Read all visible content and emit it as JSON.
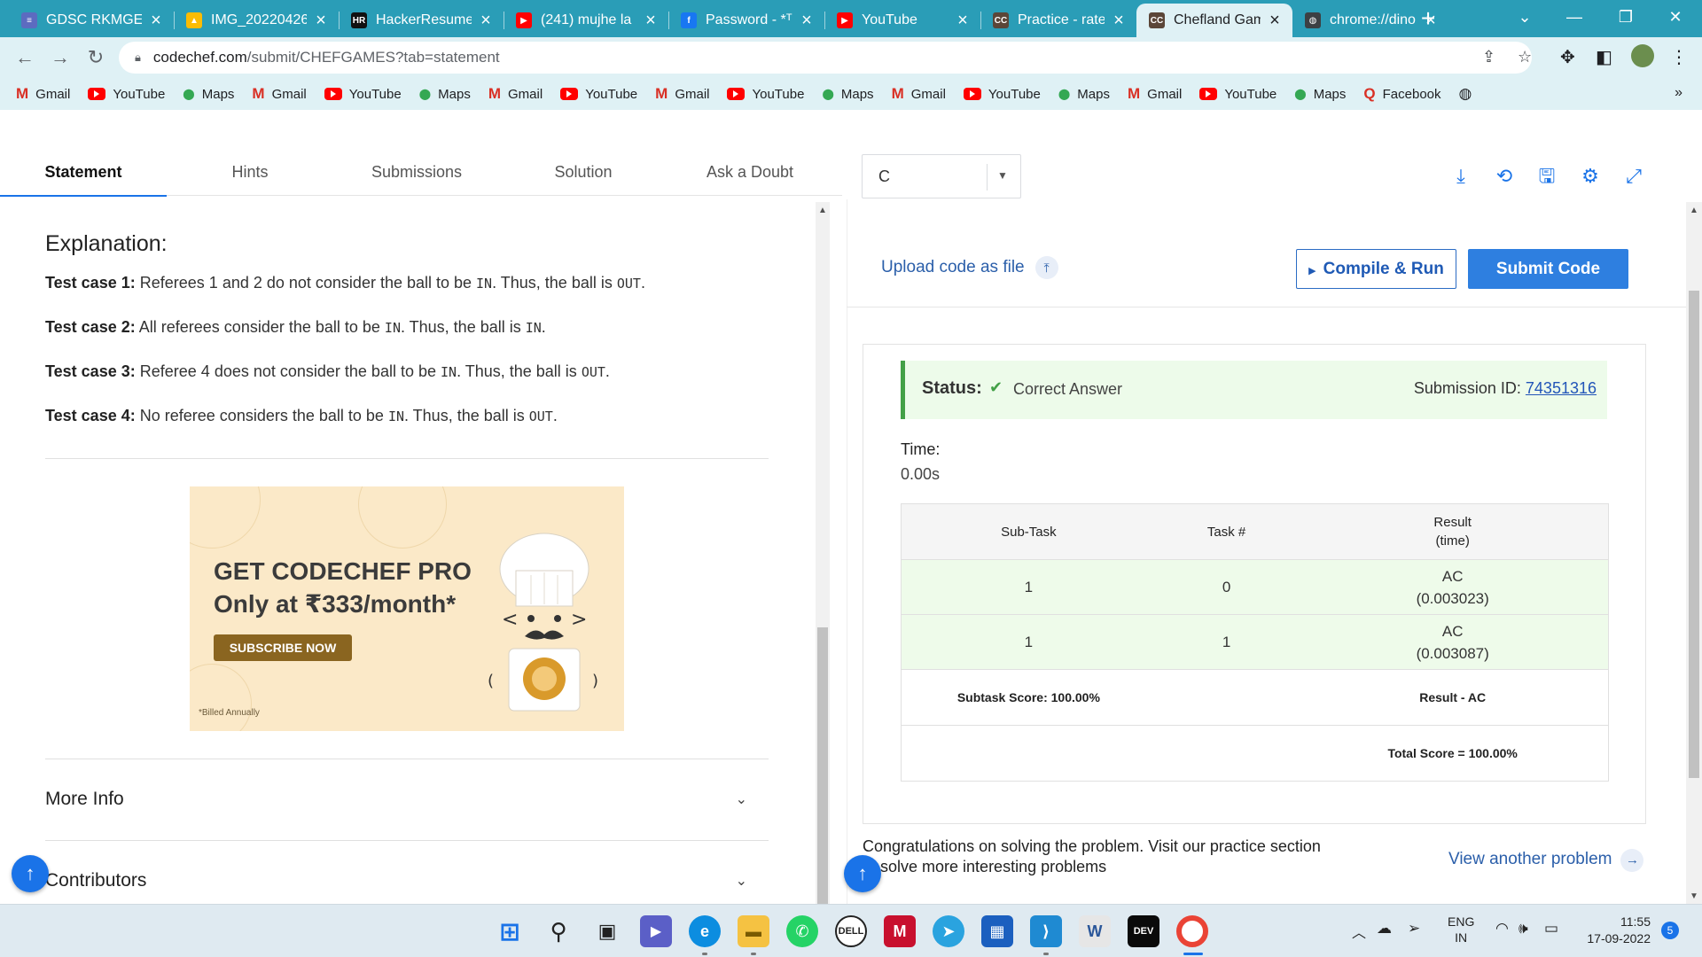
{
  "browser": {
    "tabs": [
      {
        "title": "GDSC RKMGEC",
        "icon": "list-icon",
        "color": "#5c6bc0",
        "glyph": "≡"
      },
      {
        "title": "IMG_20220426",
        "icon": "drive-icon",
        "color": "#fbbc04",
        "glyph": "▲"
      },
      {
        "title": "HackerResume",
        "icon": "hackerresume-icon",
        "color": "#111111",
        "glyph": "HR"
      },
      {
        "title": "(241) mujhe la",
        "icon": "youtube-icon",
        "color": "#ff0000",
        "glyph": "▶"
      },
      {
        "title": "Password - *ᵀ",
        "icon": "facebook-icon",
        "color": "#1877f2",
        "glyph": "f"
      },
      {
        "title": "YouTube",
        "icon": "youtube-icon",
        "color": "#ff0000",
        "glyph": "▶"
      },
      {
        "title": "Practice - rate",
        "icon": "codechef-icon",
        "color": "#5b4638",
        "glyph": "CC"
      },
      {
        "title": "Chefland Gam",
        "icon": "codechef-icon",
        "color": "#5b4638",
        "glyph": "CC"
      },
      {
        "title": "chrome://dino",
        "icon": "globe-icon",
        "color": "#3c4043",
        "glyph": "◍"
      }
    ],
    "url_host": "codechef.com",
    "url_path": "/submit/CHEFGAMES?tab=statement",
    "bookmarks": [
      {
        "label": "Gmail",
        "type": "gmail"
      },
      {
        "label": "YouTube",
        "type": "yt"
      },
      {
        "label": "Maps",
        "type": "maps"
      },
      {
        "label": "Gmail",
        "type": "gmail"
      },
      {
        "label": "YouTube",
        "type": "yt"
      },
      {
        "label": "Maps",
        "type": "maps"
      },
      {
        "label": "Gmail",
        "type": "gmail"
      },
      {
        "label": "YouTube",
        "type": "yt"
      },
      {
        "label": "Gmail",
        "type": "gmail"
      },
      {
        "label": "YouTube",
        "type": "yt"
      },
      {
        "label": "Maps",
        "type": "maps"
      },
      {
        "label": "Gmail",
        "type": "gmail"
      },
      {
        "label": "YouTube",
        "type": "yt"
      },
      {
        "label": "Maps",
        "type": "maps"
      },
      {
        "label": "Gmail",
        "type": "gmail"
      },
      {
        "label": "YouTube",
        "type": "yt"
      },
      {
        "label": "Maps",
        "type": "maps"
      },
      {
        "label": "Facebook",
        "type": "fb"
      }
    ]
  },
  "problem": {
    "tabs": [
      "Statement",
      "Hints",
      "Submissions",
      "Solution",
      "Ask a Doubt"
    ],
    "explanation_title": "Explanation:",
    "test_cases": [
      {
        "label": "Test case",
        "num": "1:",
        "parts": [
          "Referees 1 and 2 do not consider the ball to be ",
          "IN",
          ". Thus, the ball is ",
          "OUT",
          "."
        ]
      },
      {
        "label": "Test case",
        "num": "2:",
        "parts": [
          "All referees consider the ball to be ",
          "IN",
          ". Thus, the ball is ",
          "IN",
          "."
        ]
      },
      {
        "label": "Test case",
        "num": "3:",
        "parts": [
          "Referee 4 does not consider the ball to be ",
          "IN",
          ". Thus, the ball is ",
          "OUT",
          "."
        ]
      },
      {
        "label": "Test case",
        "num": "4:",
        "parts": [
          "No referee considers the ball to be ",
          "IN",
          ". Thus, the ball is ",
          "OUT",
          "."
        ]
      }
    ],
    "ad": {
      "line1": "GET CODECHEF PRO",
      "line2": "Only at ₹333/month*",
      "button": "SUBSCRIBE NOW",
      "note": "*Billed Annually"
    },
    "more_info": "More Info",
    "contributors": "Contributors"
  },
  "editor": {
    "language": "C",
    "upload_label": "Upload code as file",
    "compile_label": "Compile & Run",
    "submit_label": "Submit Code"
  },
  "result": {
    "status_label": "Status:",
    "status_value": "Correct Answer",
    "submission_label": "Submission ID:",
    "submission_id": "74351316",
    "time_label": "Time:",
    "time_value": "0.00s",
    "table_headers": [
      "Sub-Task",
      "Task #",
      "Result\n(time)"
    ],
    "rows": [
      {
        "subtask": "1",
        "task": "0",
        "result": "AC",
        "time": "(0.003023)"
      },
      {
        "subtask": "1",
        "task": "1",
        "result": "AC",
        "time": "(0.003087)"
      }
    ],
    "subtask_score": "Subtask Score: 100.00%",
    "result_summary": "Result - AC",
    "total_score": "Total Score = 100.00%",
    "congrats": "Congratulations on solving the problem. Visit our practice section to solve more interesting problems",
    "view_another": "View another problem"
  },
  "taskbar": {
    "lang_top": "ENG",
    "lang_bottom": "IN",
    "time": "11:55",
    "date": "17-09-2022",
    "notifications": "5"
  },
  "colors": {
    "tab_strip": "#2a9db7",
    "toolbar": "#dff1f5",
    "accent": "#1a73e8",
    "success": "#43a047"
  }
}
